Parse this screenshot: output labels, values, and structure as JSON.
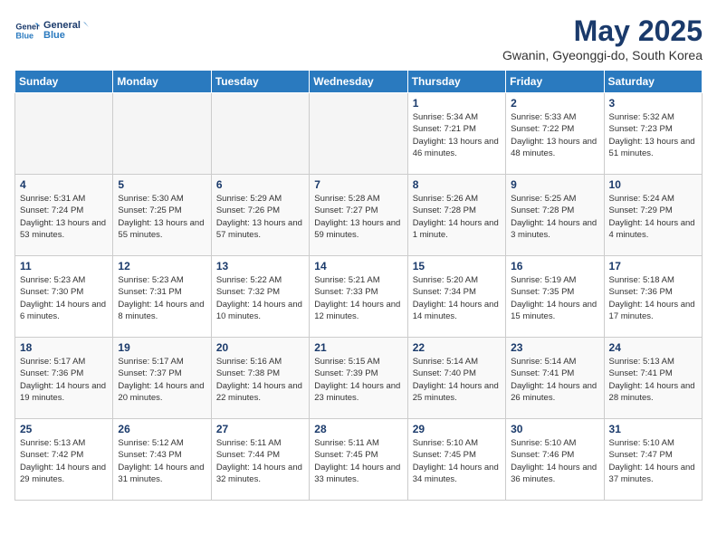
{
  "header": {
    "logo_line1": "General",
    "logo_line2": "Blue",
    "month": "May 2025",
    "location": "Gwanin, Gyeonggi-do, South Korea"
  },
  "weekdays": [
    "Sunday",
    "Monday",
    "Tuesday",
    "Wednesday",
    "Thursday",
    "Friday",
    "Saturday"
  ],
  "weeks": [
    [
      {
        "day": "",
        "empty": true
      },
      {
        "day": "",
        "empty": true
      },
      {
        "day": "",
        "empty": true
      },
      {
        "day": "",
        "empty": true
      },
      {
        "day": "1",
        "sunrise": "5:34 AM",
        "sunset": "7:21 PM",
        "daylight": "13 hours and 46 minutes."
      },
      {
        "day": "2",
        "sunrise": "5:33 AM",
        "sunset": "7:22 PM",
        "daylight": "13 hours and 48 minutes."
      },
      {
        "day": "3",
        "sunrise": "5:32 AM",
        "sunset": "7:23 PM",
        "daylight": "13 hours and 51 minutes."
      }
    ],
    [
      {
        "day": "4",
        "sunrise": "5:31 AM",
        "sunset": "7:24 PM",
        "daylight": "13 hours and 53 minutes."
      },
      {
        "day": "5",
        "sunrise": "5:30 AM",
        "sunset": "7:25 PM",
        "daylight": "13 hours and 55 minutes."
      },
      {
        "day": "6",
        "sunrise": "5:29 AM",
        "sunset": "7:26 PM",
        "daylight": "13 hours and 57 minutes."
      },
      {
        "day": "7",
        "sunrise": "5:28 AM",
        "sunset": "7:27 PM",
        "daylight": "13 hours and 59 minutes."
      },
      {
        "day": "8",
        "sunrise": "5:26 AM",
        "sunset": "7:28 PM",
        "daylight": "14 hours and 1 minute."
      },
      {
        "day": "9",
        "sunrise": "5:25 AM",
        "sunset": "7:28 PM",
        "daylight": "14 hours and 3 minutes."
      },
      {
        "day": "10",
        "sunrise": "5:24 AM",
        "sunset": "7:29 PM",
        "daylight": "14 hours and 4 minutes."
      }
    ],
    [
      {
        "day": "11",
        "sunrise": "5:23 AM",
        "sunset": "7:30 PM",
        "daylight": "14 hours and 6 minutes."
      },
      {
        "day": "12",
        "sunrise": "5:23 AM",
        "sunset": "7:31 PM",
        "daylight": "14 hours and 8 minutes."
      },
      {
        "day": "13",
        "sunrise": "5:22 AM",
        "sunset": "7:32 PM",
        "daylight": "14 hours and 10 minutes."
      },
      {
        "day": "14",
        "sunrise": "5:21 AM",
        "sunset": "7:33 PM",
        "daylight": "14 hours and 12 minutes."
      },
      {
        "day": "15",
        "sunrise": "5:20 AM",
        "sunset": "7:34 PM",
        "daylight": "14 hours and 14 minutes."
      },
      {
        "day": "16",
        "sunrise": "5:19 AM",
        "sunset": "7:35 PM",
        "daylight": "14 hours and 15 minutes."
      },
      {
        "day": "17",
        "sunrise": "5:18 AM",
        "sunset": "7:36 PM",
        "daylight": "14 hours and 17 minutes."
      }
    ],
    [
      {
        "day": "18",
        "sunrise": "5:17 AM",
        "sunset": "7:36 PM",
        "daylight": "14 hours and 19 minutes."
      },
      {
        "day": "19",
        "sunrise": "5:17 AM",
        "sunset": "7:37 PM",
        "daylight": "14 hours and 20 minutes."
      },
      {
        "day": "20",
        "sunrise": "5:16 AM",
        "sunset": "7:38 PM",
        "daylight": "14 hours and 22 minutes."
      },
      {
        "day": "21",
        "sunrise": "5:15 AM",
        "sunset": "7:39 PM",
        "daylight": "14 hours and 23 minutes."
      },
      {
        "day": "22",
        "sunrise": "5:14 AM",
        "sunset": "7:40 PM",
        "daylight": "14 hours and 25 minutes."
      },
      {
        "day": "23",
        "sunrise": "5:14 AM",
        "sunset": "7:41 PM",
        "daylight": "14 hours and 26 minutes."
      },
      {
        "day": "24",
        "sunrise": "5:13 AM",
        "sunset": "7:41 PM",
        "daylight": "14 hours and 28 minutes."
      }
    ],
    [
      {
        "day": "25",
        "sunrise": "5:13 AM",
        "sunset": "7:42 PM",
        "daylight": "14 hours and 29 minutes."
      },
      {
        "day": "26",
        "sunrise": "5:12 AM",
        "sunset": "7:43 PM",
        "daylight": "14 hours and 31 minutes."
      },
      {
        "day": "27",
        "sunrise": "5:11 AM",
        "sunset": "7:44 PM",
        "daylight": "14 hours and 32 minutes."
      },
      {
        "day": "28",
        "sunrise": "5:11 AM",
        "sunset": "7:45 PM",
        "daylight": "14 hours and 33 minutes."
      },
      {
        "day": "29",
        "sunrise": "5:10 AM",
        "sunset": "7:45 PM",
        "daylight": "14 hours and 34 minutes."
      },
      {
        "day": "30",
        "sunrise": "5:10 AM",
        "sunset": "7:46 PM",
        "daylight": "14 hours and 36 minutes."
      },
      {
        "day": "31",
        "sunrise": "5:10 AM",
        "sunset": "7:47 PM",
        "daylight": "14 hours and 37 minutes."
      }
    ]
  ],
  "labels": {
    "sunrise_prefix": "Sunrise: ",
    "sunset_prefix": "Sunset: ",
    "daylight_prefix": "Daylight: "
  }
}
